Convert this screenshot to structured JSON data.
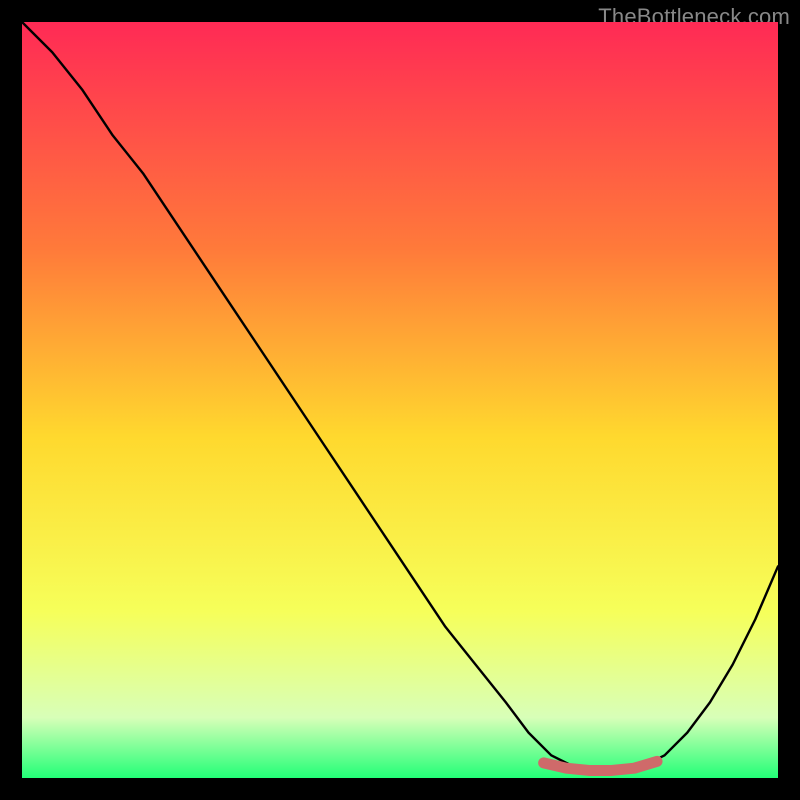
{
  "watermark": "TheBottleneck.com",
  "colors": {
    "frame": "#000000",
    "watermark": "#888888",
    "curve": "#000000",
    "highlight": "#cf6a6a",
    "gradient_top": "#ff2a55",
    "gradient_mid_upper": "#ff7a3a",
    "gradient_mid": "#ffd92e",
    "gradient_mid_lower": "#f6ff5a",
    "gradient_lower": "#d8ffb8",
    "gradient_bottom": "#22ff77"
  },
  "chart_data": {
    "type": "line",
    "title": "",
    "xlabel": "",
    "ylabel": "",
    "xlim": [
      0,
      100
    ],
    "ylim": [
      0,
      100
    ],
    "curve": {
      "x": [
        0,
        4,
        8,
        12,
        16,
        20,
        24,
        28,
        32,
        36,
        40,
        44,
        48,
        52,
        56,
        60,
        64,
        67,
        70,
        73,
        76,
        79,
        82,
        85,
        88,
        91,
        94,
        97,
        100
      ],
      "y": [
        100,
        96,
        91,
        85,
        80,
        74,
        68,
        62,
        56,
        50,
        44,
        38,
        32,
        26,
        20,
        15,
        10,
        6,
        3,
        1.5,
        1,
        1,
        1.5,
        3,
        6,
        10,
        15,
        21,
        28
      ]
    },
    "highlight_segment": {
      "x": [
        69,
        72,
        75,
        78,
        81,
        84
      ],
      "y": [
        2,
        1.3,
        1,
        1,
        1.3,
        2.2
      ]
    },
    "gradient_stops": [
      {
        "offset": 0.0,
        "color_key": "gradient_top"
      },
      {
        "offset": 0.3,
        "color_key": "gradient_mid_upper"
      },
      {
        "offset": 0.55,
        "color_key": "gradient_mid"
      },
      {
        "offset": 0.78,
        "color_key": "gradient_mid_lower"
      },
      {
        "offset": 0.92,
        "color_key": "gradient_lower"
      },
      {
        "offset": 1.0,
        "color_key": "gradient_bottom"
      }
    ]
  }
}
